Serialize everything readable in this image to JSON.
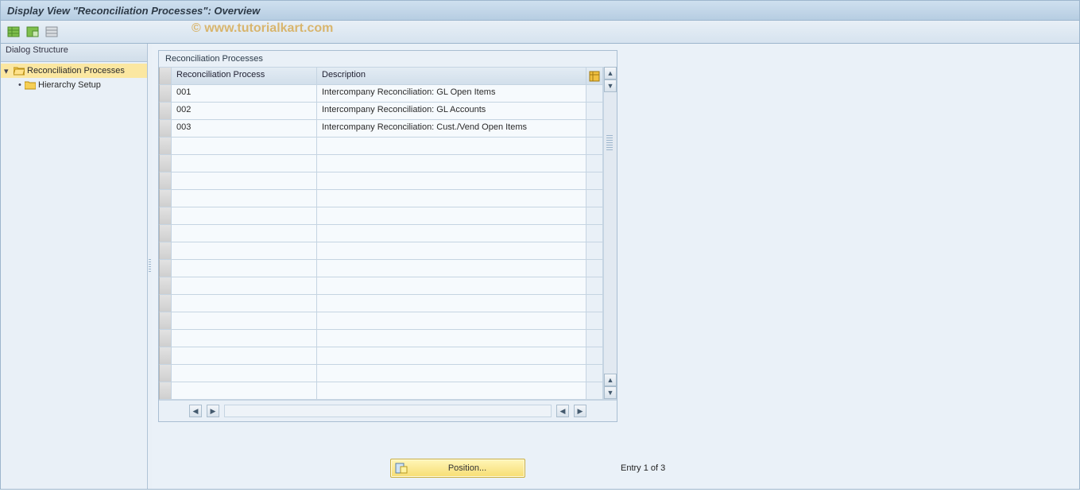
{
  "title": "Display View \"Reconciliation Processes\": Overview",
  "watermark": "© www.tutorialkart.com",
  "toolbar": {
    "icons": [
      "table-green-icon",
      "table-green2-icon",
      "table-grey-icon"
    ]
  },
  "sidebar": {
    "header": "Dialog Structure",
    "items": [
      {
        "label": "Reconciliation Processes",
        "selected": true,
        "expanded": true
      },
      {
        "label": "Hierarchy Setup",
        "selected": false
      }
    ]
  },
  "panel": {
    "title": "Reconciliation Processes",
    "columns": {
      "proc": "Reconciliation Process",
      "desc": "Description"
    },
    "rows": [
      {
        "proc": "001",
        "desc": "Intercompany Reconciliation: GL Open Items"
      },
      {
        "proc": "002",
        "desc": "Intercompany Reconciliation: GL Accounts"
      },
      {
        "proc": "003",
        "desc": "Intercompany Reconciliation: Cust./Vend Open Items"
      }
    ],
    "empty_rows": 15
  },
  "footer": {
    "position_label": "Position...",
    "entry_text": "Entry 1 of 3"
  }
}
